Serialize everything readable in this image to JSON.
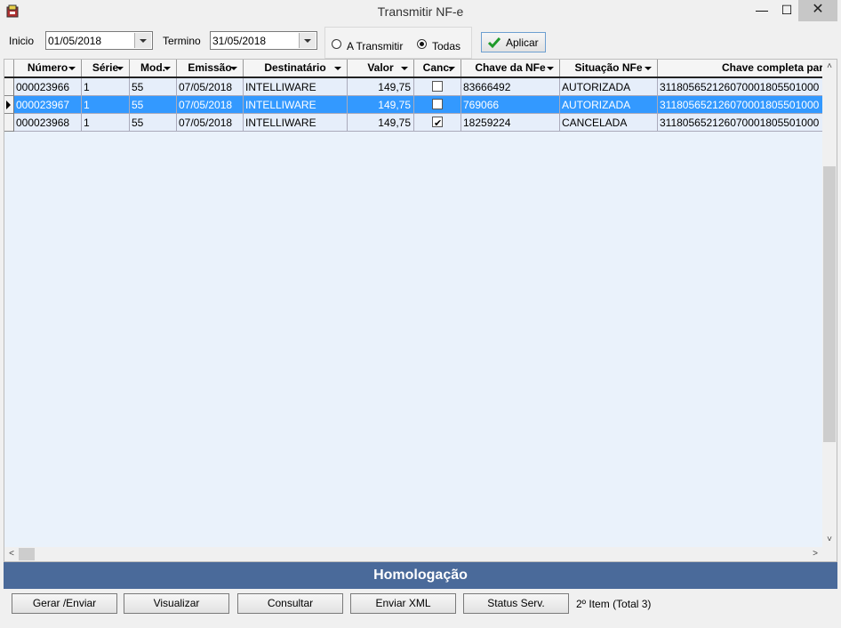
{
  "window": {
    "title": "Transmitir NF-e",
    "min": "—",
    "max": "☐",
    "close": "✕"
  },
  "filters": {
    "inicio_label": "Inicio",
    "inicio_value": "01/05/2018",
    "termino_label": "Termino",
    "termino_value": "31/05/2018",
    "radio_a_transmitir": "A Transmitir",
    "radio_todas": "Todas",
    "selected_radio": "Todas",
    "apply_label": "Aplicar"
  },
  "grid": {
    "columns": [
      "Número",
      "Série",
      "Mod.",
      "Emissão",
      "Destinatário",
      "Valor",
      "Canc.",
      "Chave da NFe",
      "Situação NFe",
      "Chave completa par"
    ],
    "rows": [
      {
        "numero": "000023966",
        "serie": "1",
        "mod": "55",
        "emissao": "07/05/2018",
        "destinatario": "INTELLIWARE",
        "valor": "149,75",
        "canc": false,
        "chave": "83666492",
        "situacao": "AUTORIZADA",
        "chave_completa": "311805652126070001805501000"
      },
      {
        "numero": "000023967",
        "serie": "1",
        "mod": "55",
        "emissao": "07/05/2018",
        "destinatario": "INTELLIWARE",
        "valor": "149,75",
        "canc": false,
        "chave": "769066",
        "situacao": "AUTORIZADA",
        "chave_completa": "311805652126070001805501000"
      },
      {
        "numero": "000023968",
        "serie": "1",
        "mod": "55",
        "emissao": "07/05/2018",
        "destinatario": "INTELLIWARE",
        "valor": "149,75",
        "canc": true,
        "chave": "18259224",
        "situacao": "CANCELADA",
        "chave_completa": "311805652126070001805501000"
      }
    ],
    "selected_row": 1
  },
  "banner": {
    "text": "Homologação"
  },
  "actions": {
    "gerar": "Gerar /Enviar",
    "visualizar": "Visualizar",
    "consultar": "Consultar",
    "enviar_xml": "Enviar XML",
    "status_serv": "Status Serv.",
    "status_text": "2º Item (Total 3)"
  },
  "colors": {
    "selected_row": "#3399ff",
    "banner": "#4a6a9a",
    "row_bg": "#e6eefa"
  }
}
